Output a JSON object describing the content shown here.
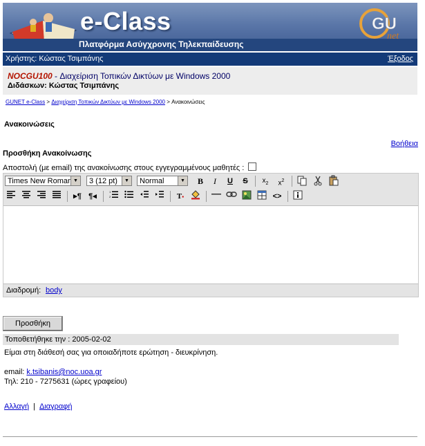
{
  "banner": {
    "title": "e-Class",
    "subtitle": "Πλατφόρμα Ασύγχρονης Τηλεκπαίδευσης",
    "partner_logo_text": "GU",
    "partner_logo_sub": "net"
  },
  "userbar": {
    "user_label": "Χρήστης: Κώστας Τσιμπάνης",
    "logout": "Έξοδος"
  },
  "course": {
    "code": "NOCGU100",
    "separator": " - ",
    "title": "Διαχείριση Τοπικών Δικτύων με Windows 2000",
    "instructor": "Διδάσκων: Κώστας Τσιμπάνης"
  },
  "breadcrumb": {
    "home": "GUNET e-Class",
    "course": "Διαχείριση Τοπικών Δικτύων με Windows 2000",
    "sep": " > ",
    "current": "Ανακοινώσεις"
  },
  "page": {
    "section_title": "Ανακοινώσεις",
    "help": "Βοήθεια",
    "add_title": "Προσθήκη Ανακοίνωσης",
    "email_label": "Αποστολή (με email) της ανακοίνωσης στους εγγεγραμμένους μαθητές :"
  },
  "editor": {
    "font_family": "Times New Roman",
    "font_size": "3 (12 pt)",
    "format": "Normal",
    "path_label": "Διαδρομή:",
    "path_value": "body"
  },
  "submit": "Προσθήκη",
  "announcement": {
    "date": "Τοποθετήθηκε την : 2005-02-02",
    "line1": "Είμαι στη διάθεσή σας για οποιαδήποτε ερώτηση - διευκρίνηση.",
    "email_label": "email: ",
    "email": "k.tsibanis@noc.uoa.gr",
    "phone": "Τηλ: 210 - 7275631 (ώρες γραφείου)"
  },
  "actions": {
    "edit": "Αλλαγή",
    "sep": "|",
    "delete": "Διαγραφή"
  },
  "colors": {
    "banner_blue": "#3e5c92",
    "userbar": "#133a78",
    "course_code": "#b41400",
    "course_title": "#000066"
  }
}
